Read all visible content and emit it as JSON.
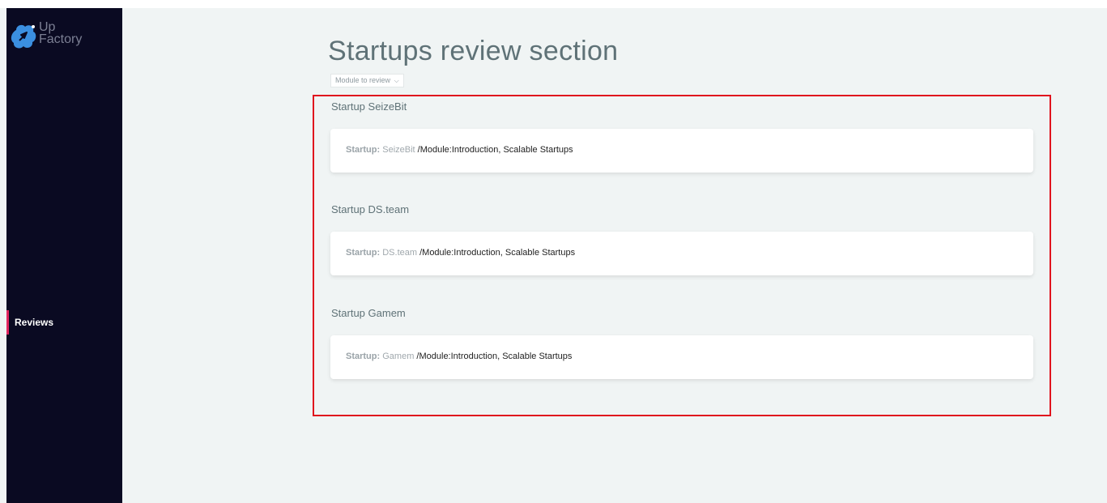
{
  "sidebar": {
    "logo": {
      "line1": "Up",
      "line2": "Factory"
    },
    "nav_items": [
      {
        "label": "Reviews",
        "active": true
      }
    ]
  },
  "main": {
    "title": "Startups review section",
    "module_select": {
      "value": "Module to review"
    },
    "groups": [
      {
        "title": "Startup SeizeBit",
        "label": "Startup:",
        "name": "SeizeBit",
        "module_text": "/Module:Introduction, Scalable Startups"
      },
      {
        "title": "Startup DS.team",
        "label": "Startup:",
        "name": "DS.team",
        "module_text": "/Module:Introduction, Scalable Startups"
      },
      {
        "title": "Startup Gamem",
        "label": "Startup:",
        "name": "Gamem",
        "module_text": "/Module:Introduction, Scalable Startups"
      }
    ]
  },
  "colors": {
    "sidebar_bg": "#0a0a22",
    "page_bg": "#f0f4f4",
    "active_indicator": "#e0245e",
    "logo_blue": "#3b8fe0",
    "highlight_border": "#e0141e"
  },
  "icons": {
    "logo": "rocket-cloud-icon",
    "dropdown": "chevron-down-icon"
  }
}
